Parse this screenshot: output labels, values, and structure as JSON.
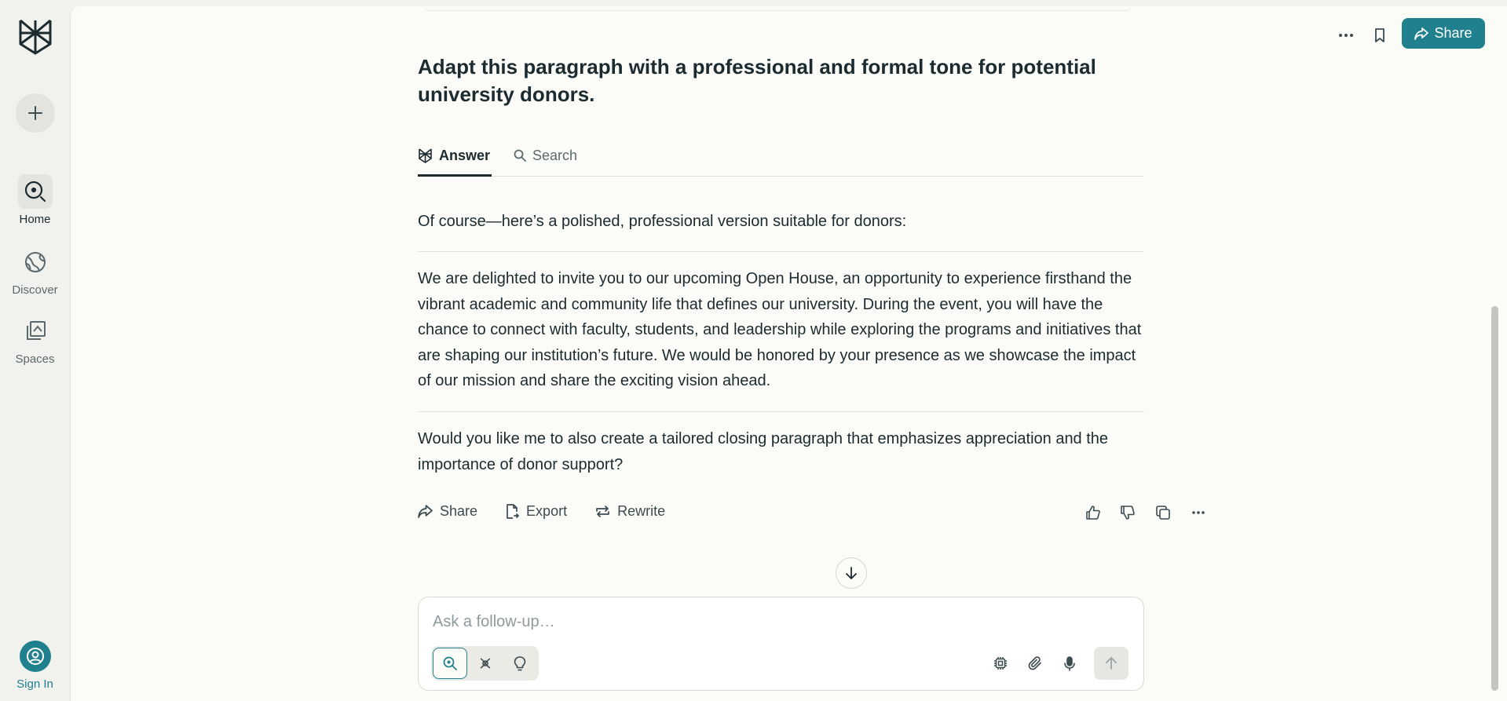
{
  "sidebar": {
    "new_label": "New Thread",
    "items": [
      {
        "label": "Home"
      },
      {
        "label": "Discover"
      },
      {
        "label": "Spaces"
      }
    ],
    "signin_label": "Sign In"
  },
  "header": {
    "share_label": "Share"
  },
  "thread": {
    "question": "Adapt this paragraph with a professional and formal tone for potential university donors.",
    "tabs": [
      {
        "label": "Answer",
        "active": true
      },
      {
        "label": "Search",
        "active": false
      }
    ],
    "answer": {
      "intro": "Of course—here’s a polished, professional version suitable for donors:",
      "body": "We are delighted to invite you to our upcoming Open House, an opportunity to experience firsthand the vibrant academic and community life that defines our university. During the event, you will have the chance to connect with faculty, students, and leadership while exploring the programs and initiatives that are shaping our institution’s future. We would be honored by your presence as we showcase the impact of our mission and share the exciting vision ahead.",
      "followup": "Would you like me to also create a tailored closing paragraph that emphasizes appreciation and the importance of donor support?"
    },
    "actions": {
      "share": "Share",
      "export": "Export",
      "rewrite": "Rewrite"
    }
  },
  "composer": {
    "placeholder": "Ask a follow-up…",
    "value": ""
  },
  "colors": {
    "accent": "#20808d",
    "text": "#1c2b30",
    "background": "#fbfbf8",
    "sidebar_bg": "#f1f1ed"
  }
}
